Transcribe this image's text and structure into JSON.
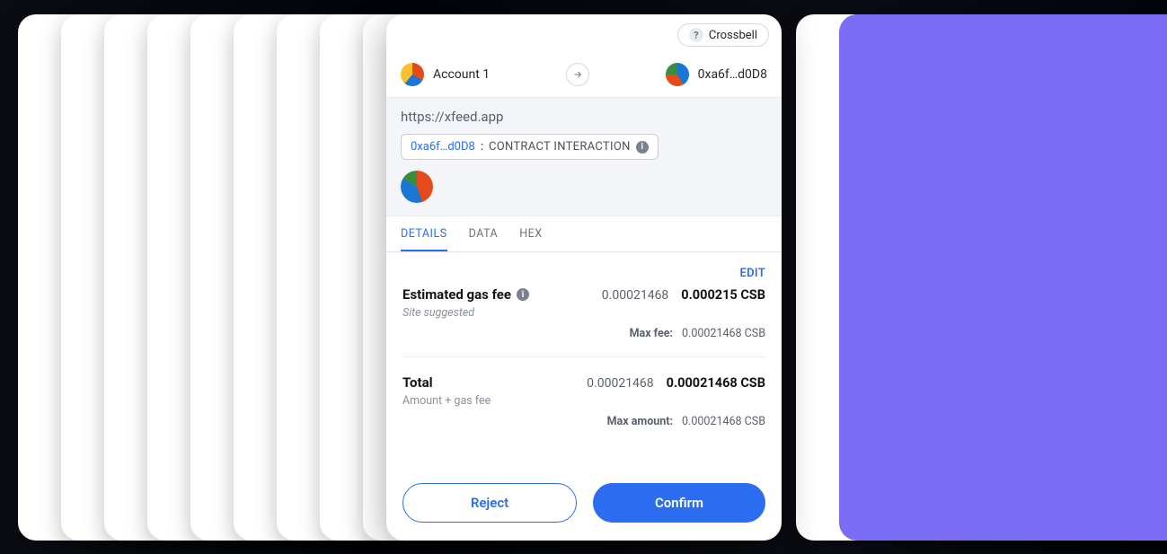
{
  "network": {
    "name": "Crossbell"
  },
  "from": {
    "label": "Account 1"
  },
  "to": {
    "address": "0xa6f…d0D8"
  },
  "origin": {
    "url": "https://xfeed.app",
    "contract_address": "0xa6f…d0D8",
    "interaction_label": "CONTRACT INTERACTION"
  },
  "tabs": {
    "details": "DETAILS",
    "data": "DATA",
    "hex": "HEX"
  },
  "details": {
    "edit": "EDIT",
    "gas": {
      "label": "Estimated gas fee",
      "sublabel": "Site suggested",
      "value_native": "0.00021468",
      "value_display": "0.000215 CSB",
      "max_label": "Max fee:",
      "max_value": "0.00021468 CSB"
    },
    "total": {
      "label": "Total",
      "sublabel": "Amount + gas fee",
      "value_native": "0.00021468",
      "value_display": "0.00021468 CSB",
      "max_label": "Max amount:",
      "max_value": "0.00021468 CSB"
    }
  },
  "actions": {
    "reject": "Reject",
    "confirm": "Confirm"
  }
}
